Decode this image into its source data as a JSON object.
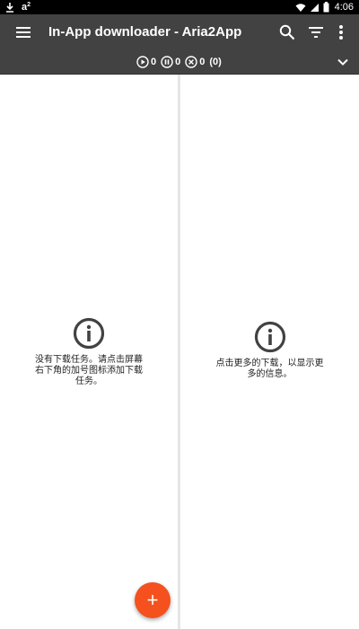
{
  "status_bar": {
    "left_glyph": "a",
    "left_glyph_sup": "2",
    "time": "4:06",
    "icons": [
      "download-arrow-icon",
      "wifi-icon",
      "cell-signal-icon",
      "battery-icon"
    ]
  },
  "app_bar": {
    "title": "In-App downloader - Aria2App",
    "actions": [
      "search-icon",
      "filter-icon",
      "more-vert-icon"
    ]
  },
  "counters": {
    "active": "0",
    "paused": "0",
    "error": "0",
    "error_extra": "(0)"
  },
  "left_panel": {
    "message": "没有下载任务。请点击屏幕右下角的加号图标添加下载任务。"
  },
  "right_panel": {
    "message": "点击更多的下载，以显示更多的信息。"
  },
  "fab": {
    "label": "+"
  },
  "colors": {
    "app_bar": "#424242",
    "status_bar": "#000000",
    "fab": "#f4511e",
    "info_icon": "#424242"
  }
}
